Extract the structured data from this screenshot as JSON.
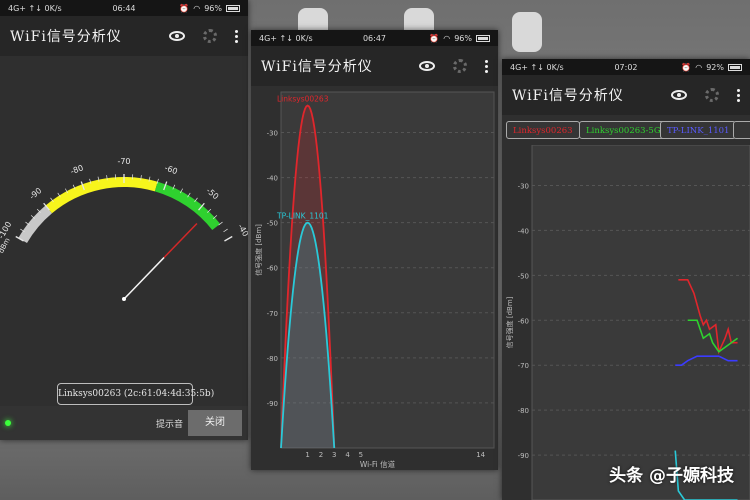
{
  "phone1": {
    "status": {
      "network": "4G+ ↑↓ 0K/s",
      "time": "06:44",
      "battery": "96%"
    },
    "title": "WiFi信号分析仪",
    "gauge": {
      "unit": "dBm",
      "ticks": [
        {
          "label": "-100",
          "v": -100
        },
        {
          "label": "-90",
          "v": -90
        },
        {
          "label": "-80",
          "v": -80
        },
        {
          "label": "-70",
          "v": -70
        },
        {
          "label": "-60",
          "v": -60
        },
        {
          "label": "-50",
          "v": -50
        },
        {
          "label": "-40",
          "v": -40
        }
      ],
      "min": -100,
      "max": -40,
      "needle_value": -48,
      "bands": [
        {
          "from": -100,
          "to": -90,
          "color": "#c8c8c8"
        },
        {
          "from": -90,
          "to": -62,
          "color": "#f7f51c"
        },
        {
          "from": -62,
          "to": -44,
          "color": "#2fd12f"
        }
      ]
    },
    "device_label": "Linksys00263 (2c:61:04:4d:35:5b)",
    "sound_label": "提示音",
    "close_label": "关闭"
  },
  "phone2": {
    "status": {
      "network": "4G+ ↑↓ 0K/s",
      "time": "06:47",
      "battery": "96%"
    },
    "title": "WiFi信号分析仪",
    "chart_data": {
      "type": "area",
      "xlabel": "Wi-Fi 信道",
      "ylabel": "信号强度 [dBm]",
      "yticks": [
        -30,
        -40,
        -50,
        -60,
        -70,
        -80,
        -90
      ],
      "ylim": [
        -100,
        -21
      ],
      "xticks": [
        1,
        2,
        3,
        4,
        5,
        14
      ],
      "xlim": [
        -1,
        15
      ],
      "grid": true,
      "series": [
        {
          "name": "Linksys00263",
          "color": "#e0262c",
          "center": 1,
          "peak": -24,
          "half_width": 2
        },
        {
          "name": "TP-LINK_1101",
          "color": "#29c9d8",
          "center": 1,
          "peak": -50,
          "half_width": 2
        }
      ]
    }
  },
  "phone3": {
    "status": {
      "network": "4G+ ↑↓ 0K/s",
      "time": "07:02",
      "battery": "92%"
    },
    "title": "WiFi信号分析仪",
    "tabs": [
      {
        "label": "Linksys00263",
        "color": "#e0262c"
      },
      {
        "label": "Linksys00263-5G",
        "color": "#2fd12f"
      },
      {
        "label": "TP-LINK_1101",
        "color": "#3b3bff"
      }
    ],
    "chart_data": {
      "type": "line",
      "ylabel": "信号强度 [dBm]",
      "yticks": [
        -30,
        -40,
        -50,
        -60,
        -70,
        -80,
        -90
      ],
      "ylim": [
        -100,
        -21
      ],
      "xlim": [
        0,
        70
      ],
      "grid": true,
      "series": [
        {
          "name": "Linksys00263",
          "color": "#e0262c",
          "x": [
            47,
            50,
            52,
            54,
            55,
            56,
            57,
            59,
            60,
            62,
            63,
            64,
            66
          ],
          "y": [
            -51,
            -51,
            -54,
            -59,
            -61,
            -60,
            -62,
            -61,
            -67,
            -64,
            -62,
            -65,
            -65
          ]
        },
        {
          "name": "Linksys00263-5G",
          "color": "#2fd12f",
          "x": [
            50,
            53,
            55,
            57,
            58,
            60,
            62,
            64,
            66
          ],
          "y": [
            -60,
            -60,
            -64,
            -63,
            -65,
            -67,
            -66,
            -65,
            -64
          ]
        },
        {
          "name": "TP-LINK_1101",
          "color": "#3b3bff",
          "x": [
            46,
            48,
            50,
            53,
            56,
            60,
            63,
            65,
            66
          ],
          "y": [
            -70,
            -70,
            -69,
            -68,
            -68,
            -68,
            -69,
            -69,
            -69
          ]
        },
        {
          "name": "",
          "color": "#29c9d8",
          "x": [
            46,
            47,
            49,
            53,
            58,
            66
          ],
          "y": [
            -89,
            -98,
            -100,
            -100,
            -100,
            -100
          ]
        }
      ]
    }
  },
  "watermark": "头条 @子嫄科技"
}
